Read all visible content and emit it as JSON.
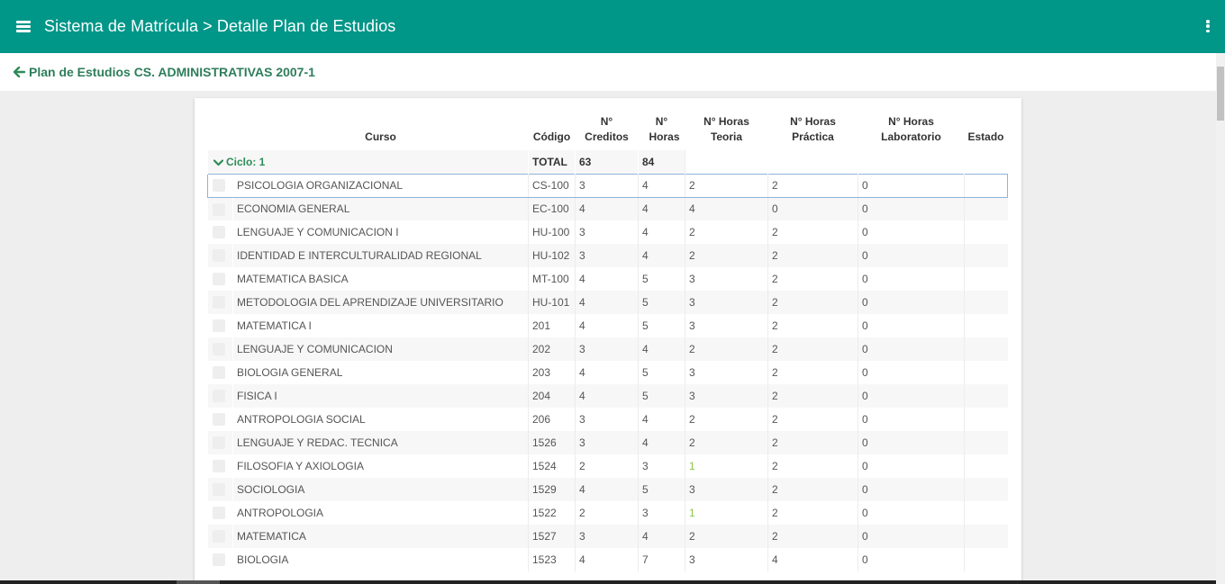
{
  "topbar": {
    "title": "Sistema de Matrícula > Detalle Plan de Estudios",
    "menu_icon": "hamburger-icon",
    "more_icon": "kebab-vertical-icon",
    "color": "#009688"
  },
  "subheader": {
    "back_label": "Plan de Estudios CS. ADMINISTRATIVAS 2007-1",
    "back_icon": "arrow-left-icon"
  },
  "table": {
    "headers": {
      "curso": "Curso",
      "codigo": "Código",
      "creditos": "N° Creditos",
      "horas": "N° Horas",
      "teoria": "N° Horas Teoria",
      "practica": "N° Horas Práctica",
      "laboratorio": "N° Horas Laboratorio",
      "estado": "Estado"
    },
    "cycle": {
      "label": "Ciclo: 1",
      "total_label": "TOTAL",
      "total_creditos": "63",
      "total_horas": "84"
    },
    "rows": [
      {
        "curso": "PSICOLOGIA ORGANIZACIONAL",
        "codigo": "CS-100",
        "creditos": "3",
        "horas": "4",
        "teoria": "2",
        "practica": "2",
        "laboratorio": "0"
      },
      {
        "curso": "ECONOMIA GENERAL",
        "codigo": "EC-100",
        "creditos": "4",
        "horas": "4",
        "teoria": "4",
        "practica": "0",
        "laboratorio": "0"
      },
      {
        "curso": "LENGUAJE Y COMUNICACION I",
        "codigo": "HU-100",
        "creditos": "3",
        "horas": "4",
        "teoria": "2",
        "practica": "2",
        "laboratorio": "0"
      },
      {
        "curso": "IDENTIDAD E INTERCULTURALIDAD REGIONAL",
        "codigo": "HU-102",
        "creditos": "3",
        "horas": "4",
        "teoria": "2",
        "practica": "2",
        "laboratorio": "0"
      },
      {
        "curso": "MATEMATICA BASICA",
        "codigo": "MT-100",
        "creditos": "4",
        "horas": "5",
        "teoria": "3",
        "practica": "2",
        "laboratorio": "0"
      },
      {
        "curso": "METODOLOGIA DEL APRENDIZAJE UNIVERSITARIO",
        "codigo": "HU-101",
        "creditos": "4",
        "horas": "5",
        "teoria": "3",
        "practica": "2",
        "laboratorio": "0"
      },
      {
        "curso": "MATEMATICA I",
        "codigo": "201",
        "creditos": "4",
        "horas": "5",
        "teoria": "3",
        "practica": "2",
        "laboratorio": "0"
      },
      {
        "curso": "LENGUAJE Y COMUNICACION",
        "codigo": "202",
        "creditos": "3",
        "horas": "4",
        "teoria": "2",
        "practica": "2",
        "laboratorio": "0"
      },
      {
        "curso": "BIOLOGIA GENERAL",
        "codigo": "203",
        "creditos": "4",
        "horas": "5",
        "teoria": "3",
        "practica": "2",
        "laboratorio": "0"
      },
      {
        "curso": "FISICA I",
        "codigo": "204",
        "creditos": "4",
        "horas": "5",
        "teoria": "3",
        "practica": "2",
        "laboratorio": "0"
      },
      {
        "curso": "ANTROPOLOGIA SOCIAL",
        "codigo": "206",
        "creditos": "3",
        "horas": "4",
        "teoria": "2",
        "practica": "2",
        "laboratorio": "0"
      },
      {
        "curso": "LENGUAJE Y REDAC. TECNICA",
        "codigo": "1526",
        "creditos": "3",
        "horas": "4",
        "teoria": "2",
        "practica": "2",
        "laboratorio": "0"
      },
      {
        "curso": "FILOSOFIA Y AXIOLOGIA",
        "codigo": "1524",
        "creditos": "2",
        "horas": "3",
        "teoria": "1",
        "practica": "2",
        "laboratorio": "0"
      },
      {
        "curso": "SOCIOLOGIA",
        "codigo": "1529",
        "creditos": "4",
        "horas": "5",
        "teoria": "3",
        "practica": "2",
        "laboratorio": "0"
      },
      {
        "curso": "ANTROPOLOGIA",
        "codigo": "1522",
        "creditos": "2",
        "horas": "3",
        "teoria": "1",
        "practica": "2",
        "laboratorio": "0"
      },
      {
        "curso": "MATEMATICA",
        "codigo": "1527",
        "creditos": "3",
        "horas": "4",
        "teoria": "2",
        "practica": "2",
        "laboratorio": "0"
      },
      {
        "curso": "BIOLOGIA",
        "codigo": "1523",
        "creditos": "4",
        "horas": "7",
        "teoria": "3",
        "practica": "4",
        "laboratorio": "0"
      }
    ]
  }
}
